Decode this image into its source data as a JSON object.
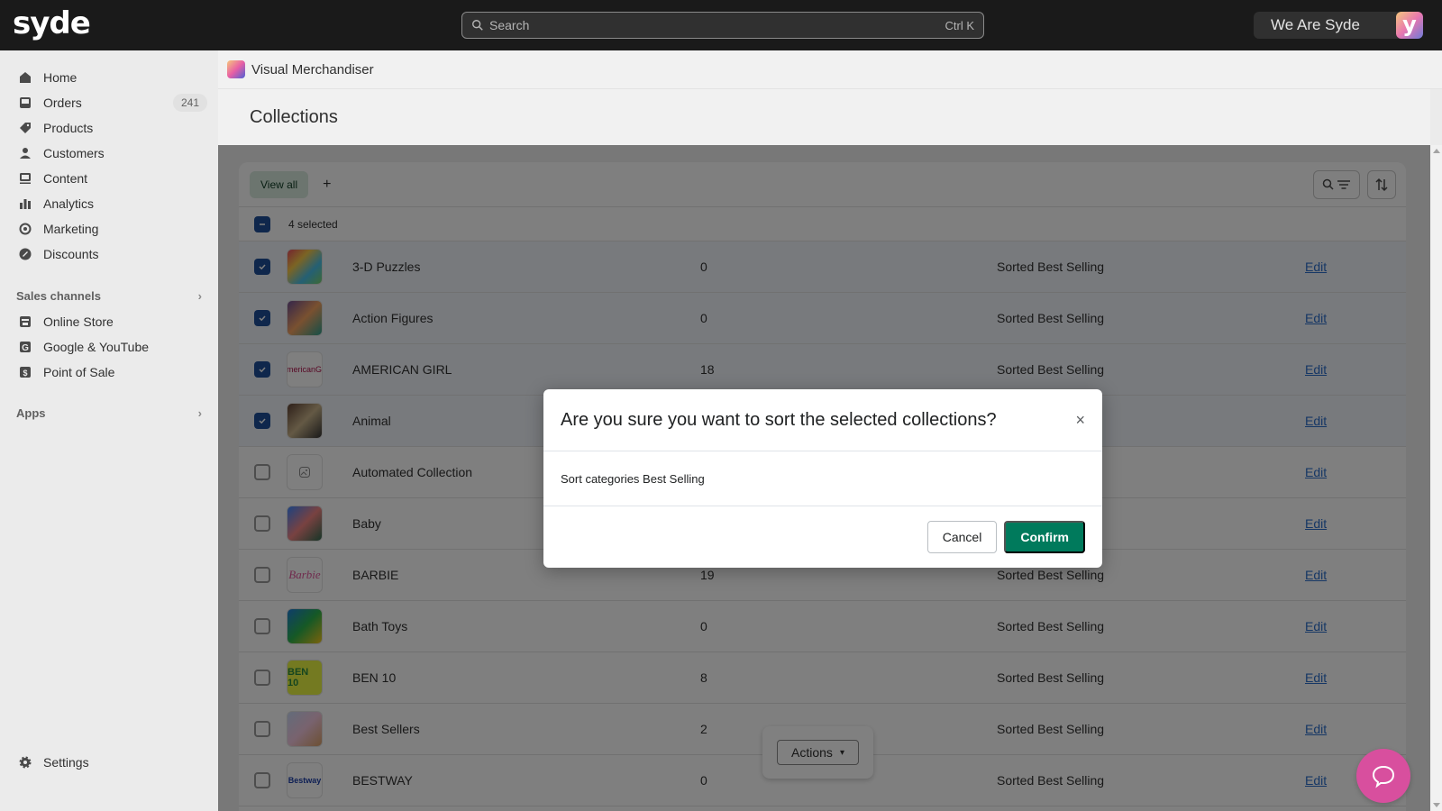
{
  "topbar": {
    "logo": "syde",
    "search_placeholder": "Search",
    "search_shortcut": "Ctrl K",
    "store_name": "We Are Syde",
    "store_avatar_letter": "y"
  },
  "sidebar": {
    "items": [
      {
        "label": "Home",
        "icon": "home-icon"
      },
      {
        "label": "Orders",
        "icon": "inbox-icon",
        "badge": "241"
      },
      {
        "label": "Products",
        "icon": "tag-icon"
      },
      {
        "label": "Customers",
        "icon": "person-icon"
      },
      {
        "label": "Content",
        "icon": "content-icon"
      },
      {
        "label": "Analytics",
        "icon": "bar-chart-icon"
      },
      {
        "label": "Marketing",
        "icon": "target-icon"
      },
      {
        "label": "Discounts",
        "icon": "discount-icon"
      }
    ],
    "sales_channels": {
      "label": "Sales channels",
      "items": [
        {
          "label": "Online Store",
          "icon": "store-icon"
        },
        {
          "label": "Google & YouTube",
          "icon": "google-icon"
        },
        {
          "label": "Point of Sale",
          "icon": "pos-icon"
        }
      ]
    },
    "apps_label": "Apps",
    "settings_label": "Settings"
  },
  "app_header": {
    "title": "Visual Merchandiser"
  },
  "page": {
    "title": "Collections",
    "tabs": [
      {
        "label": "View all"
      }
    ],
    "add_tab_label": "+",
    "selected_count": "4 selected",
    "rows": [
      {
        "name": "3-D Puzzles",
        "count": "0",
        "sort": "Sorted Best Selling",
        "edit": "Edit",
        "selected": true,
        "thumb": "puzzles"
      },
      {
        "name": "Action Figures",
        "count": "0",
        "sort": "Sorted Best Selling",
        "edit": "Edit",
        "selected": true,
        "thumb": "figures"
      },
      {
        "name": "AMERICAN GIRL",
        "count": "18",
        "sort": "Sorted Best Selling",
        "edit": "Edit",
        "selected": true,
        "thumb": "americangirl"
      },
      {
        "name": "Animal",
        "count": "",
        "sort": "",
        "edit": "Edit",
        "selected": true,
        "thumb": "animal"
      },
      {
        "name": "Automated Collection",
        "count": "",
        "sort": "",
        "edit": "Edit",
        "selected": false,
        "thumb": "placeholder"
      },
      {
        "name": "Baby",
        "count": "",
        "sort": "",
        "edit": "Edit",
        "selected": false,
        "thumb": "baby"
      },
      {
        "name": "BARBIE",
        "count": "19",
        "sort": "Sorted Best Selling",
        "edit": "Edit",
        "selected": false,
        "thumb": "barbie"
      },
      {
        "name": "Bath Toys",
        "count": "0",
        "sort": "Sorted Best Selling",
        "edit": "Edit",
        "selected": false,
        "thumb": "bath"
      },
      {
        "name": "BEN 10",
        "count": "8",
        "sort": "Sorted Best Selling",
        "edit": "Edit",
        "selected": false,
        "thumb": "ben10"
      },
      {
        "name": "Best Sellers",
        "count": "2",
        "sort": "Sorted Best Selling",
        "edit": "Edit",
        "selected": false,
        "thumb": "bestsellers"
      },
      {
        "name": "BESTWAY",
        "count": "0",
        "sort": "Sorted Best Selling",
        "edit": "Edit",
        "selected": false,
        "thumb": "bestway"
      }
    ],
    "thumb_text": {
      "americangirl": "AmericanGirl",
      "barbie": "Barbie",
      "ben10": "BEN 10",
      "bestway": "Bestway"
    },
    "actions_label": "Actions"
  },
  "modal": {
    "title": "Are you sure you want to sort the selected collections?",
    "body": "Sort categories Best Selling",
    "cancel_label": "Cancel",
    "confirm_label": "Confirm",
    "close_glyph": "×"
  },
  "colors": {
    "primary": "#007a5c",
    "checkbox": "#1f4f99",
    "chat": "#d84f9e",
    "link": "#2c6ecb"
  }
}
